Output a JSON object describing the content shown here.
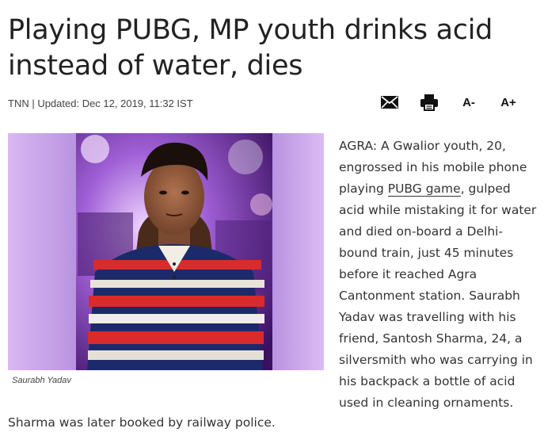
{
  "article": {
    "headline": "Playing PUBG, MP youth drinks acid instead of water, dies",
    "meta": "TNN | Updated: Dec 12, 2019, 11:32 IST",
    "tools": {
      "mail_icon": "mail-icon",
      "print_icon": "print-icon",
      "decrease_label": "A-",
      "increase_label": "A+"
    },
    "image": {
      "subject": "portrait photo",
      "caption": "Saurabh Yadav"
    },
    "body": {
      "before_link": "AGRA: A Gwalior youth, 20, engrossed in his mobile phone playing ",
      "link_text": "PUBG game",
      "after_link": ", gulped acid while mistaking it for water and died on-board a Delhi-bound train, just 45 minutes before it reached Agra Cantonment station. Saurabh Yadav was travelling with his friend, Santosh Sharma, 24, a silversmith who was carrying in his backpack a bottle of acid used in cleaning ornaments."
    },
    "bottom_paragraph": "Sharma was later booked by railway police."
  }
}
